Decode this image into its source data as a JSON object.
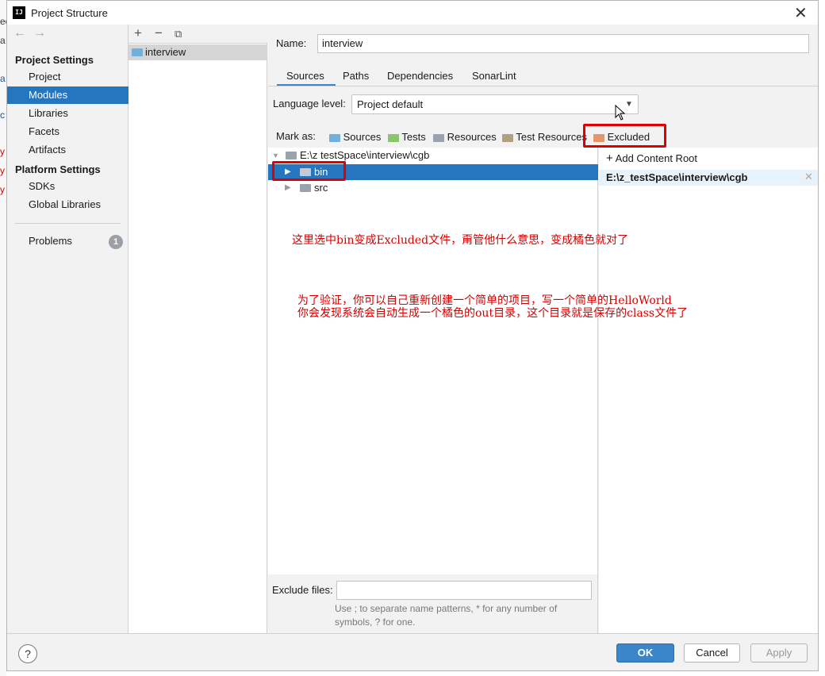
{
  "background_fragments": [
    "ec",
    "a",
    "a",
    "c",
    "y",
    "y",
    "y"
  ],
  "window": {
    "title": "Project Structure",
    "app_icon": "IJ"
  },
  "nav": {
    "project_settings_heading": "Project Settings",
    "platform_settings_heading": "Platform Settings",
    "items": [
      "Project",
      "Modules",
      "Libraries",
      "Facets",
      "Artifacts"
    ],
    "platform_items": [
      "SDKs",
      "Global Libraries"
    ],
    "problems_label": "Problems",
    "problems_count": "1",
    "selected": "Modules"
  },
  "modules": {
    "items": [
      "interview"
    ]
  },
  "main": {
    "name_label": "Name:",
    "name_value": "interview",
    "tabs": [
      "Sources",
      "Paths",
      "Dependencies",
      "SonarLint"
    ],
    "active_tab": "Sources",
    "language_level_label": "Language level:",
    "language_level_value": "Project default",
    "mark_as_label": "Mark as:",
    "mark_as": [
      "Sources",
      "Tests",
      "Resources",
      "Test Resources",
      "Excluded"
    ],
    "tree": {
      "root": "E:\\z testSpace\\interview\\cgb",
      "children": [
        "bin",
        "src"
      ]
    },
    "add_content_root": "Add Content Root",
    "content_root": "E:\\z_testSpace\\interview\\cgb",
    "exclude_files_label": "Exclude files:",
    "exclude_hint": "Use ; to separate name patterns, * for any number of symbols, ? for one."
  },
  "annotations": {
    "note1": "这里选中bin变成Excluded文件，甭管他什么意思，变成橘色就对了",
    "note2": "为了验证，你可以自己重新创建一个简单的项目，写一个简单的HelloWorld",
    "note3": "你会发现系统会自动生成一个橘色的out目录，这个目录就是保存的class文件了"
  },
  "footer": {
    "help": "?",
    "ok": "OK",
    "cancel": "Cancel",
    "apply": "Apply"
  },
  "colors": {
    "selection": "#2675bf",
    "annotation_red": "#e00000",
    "excluded_orange": "#e8946a"
  }
}
